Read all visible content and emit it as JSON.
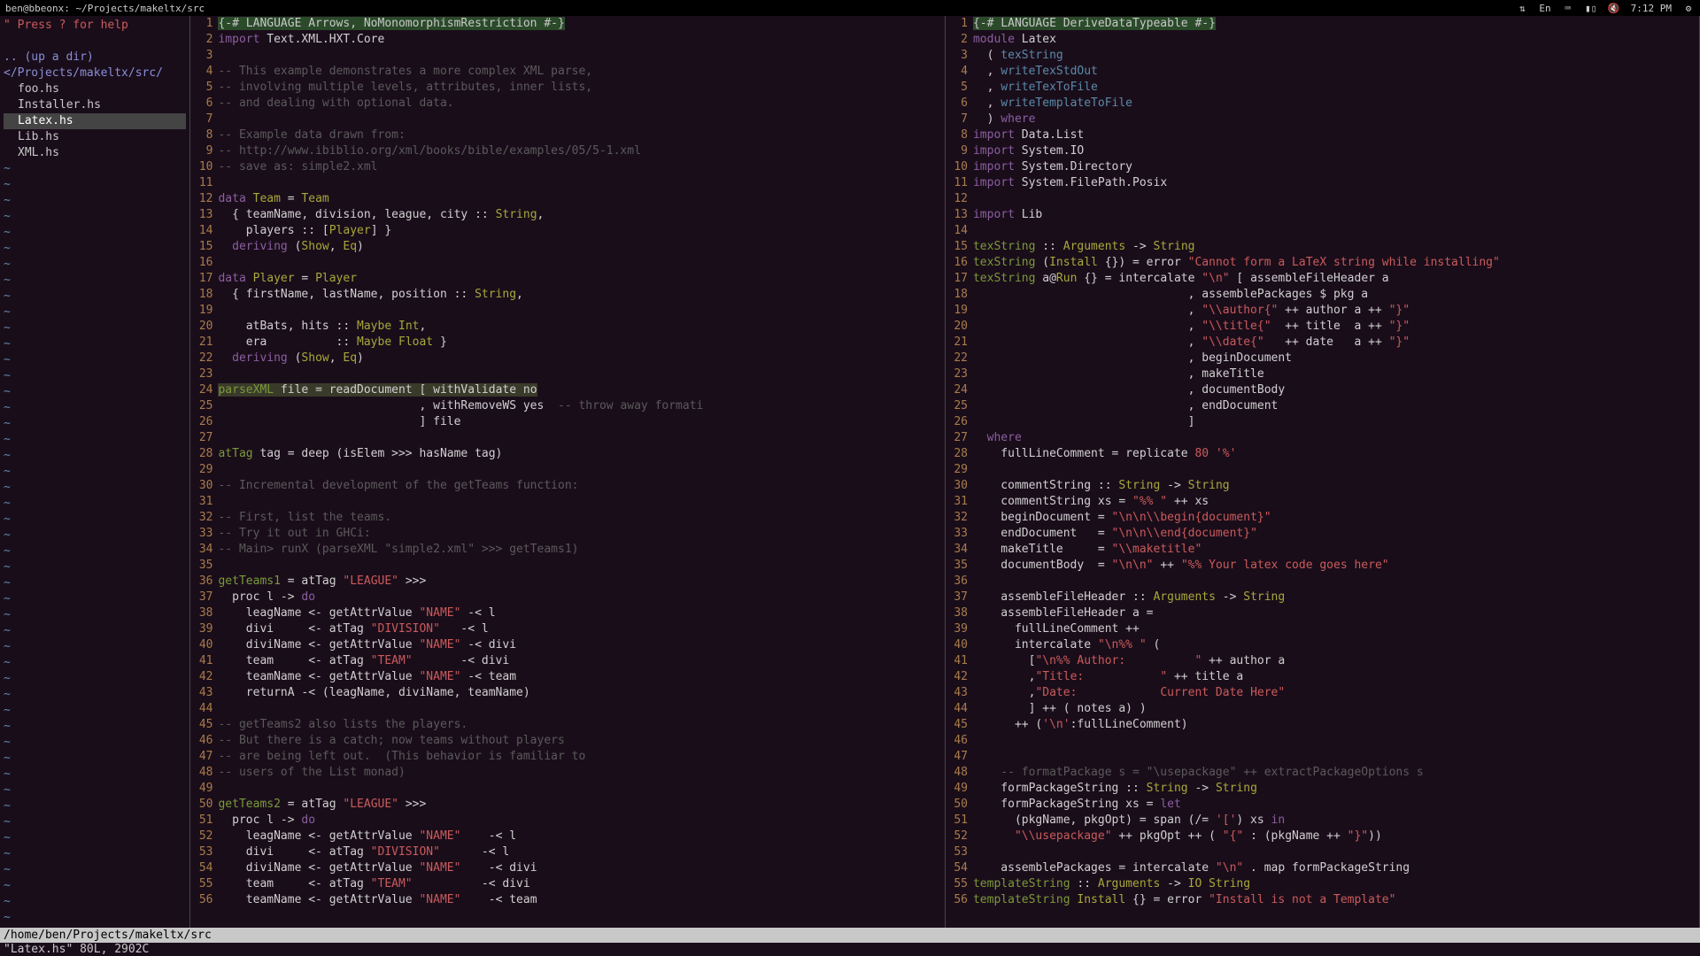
{
  "statusbar": {
    "title": "ben@bbeonx: ~/Projects/makeltx/src",
    "lang": "En",
    "time": "7:12 PM"
  },
  "filetree": {
    "help": "\" Press ? for help",
    "updir": ".. (up a dir)",
    "path": "</Projects/makeltx/src/",
    "files": [
      "foo.hs",
      "Installer.hs",
      "Latex.hs",
      "Lib.hs",
      "XML.hs"
    ],
    "selected": "Latex.hs"
  },
  "left_pane": {
    "lines": [
      {
        "n": 1,
        "html": "<span class='c-pragma'>{-# LANGUAGE Arrows, NoMonomorphismRestriction #-}</span>"
      },
      {
        "n": 2,
        "html": "<span class='c-kw'>import</span> Text.XML.HXT.Core"
      },
      {
        "n": 3,
        "html": ""
      },
      {
        "n": 4,
        "html": "<span class='c-cm'>-- This example demonstrates a more complex XML parse,</span>"
      },
      {
        "n": 5,
        "html": "<span class='c-cm'>-- involving multiple levels, attributes, inner lists,</span>"
      },
      {
        "n": 6,
        "html": "<span class='c-cm'>-- and dealing with optional data.</span>"
      },
      {
        "n": 7,
        "html": ""
      },
      {
        "n": 8,
        "html": "<span class='c-cm'>-- Example data drawn from:</span>"
      },
      {
        "n": 9,
        "html": "<span class='c-cm'>-- http://www.ibiblio.org/xml/books/bible/examples/05/5-1.xml</span>"
      },
      {
        "n": 10,
        "html": "<span class='c-cm'>-- save as: simple2.xml</span>"
      },
      {
        "n": 11,
        "html": ""
      },
      {
        "n": 12,
        "html": "<span class='c-kw'>data</span> <span class='c-ty'>Team</span> = <span class='c-ty'>Team</span>"
      },
      {
        "n": 13,
        "html": "  { teamName, division, league, city :: <span class='c-ty'>String</span>,"
      },
      {
        "n": 14,
        "html": "    players :: [<span class='c-ty'>Player</span>] }"
      },
      {
        "n": 15,
        "html": "  <span class='c-kw'>deriving</span> (<span class='c-ty'>Show</span>, <span class='c-ty'>Eq</span>)"
      },
      {
        "n": 16,
        "html": ""
      },
      {
        "n": 17,
        "html": "<span class='c-kw'>data</span> <span class='c-ty'>Player</span> = <span class='c-ty'>Player</span>"
      },
      {
        "n": 18,
        "html": "  { firstName, lastName, position :: <span class='c-ty'>String</span>,"
      },
      {
        "n": 19,
        "html": ""
      },
      {
        "n": 20,
        "html": "    atBats, hits :: <span class='c-ty'>Maybe Int</span>,"
      },
      {
        "n": 21,
        "html": "    era          :: <span class='c-ty'>Maybe Float</span> }"
      },
      {
        "n": 22,
        "html": "  <span class='c-kw'>deriving</span> (<span class='c-ty'>Show</span>, <span class='c-ty'>Eq</span>)"
      },
      {
        "n": 23,
        "html": ""
      },
      {
        "n": 24,
        "html": "<span class='c-hl'><span class='c-fn'>parseXML</span> file = readDocument [ withValidate no</span>"
      },
      {
        "n": 25,
        "html": "                             , withRemoveWS yes  <span class='c-cm'>-- throw away formati</span>"
      },
      {
        "n": 26,
        "html": "                             ] file"
      },
      {
        "n": 27,
        "html": ""
      },
      {
        "n": 28,
        "html": "<span class='c-fn'>atTag</span> tag = deep (isElem &gt;&gt;&gt; hasName tag)"
      },
      {
        "n": 29,
        "html": ""
      },
      {
        "n": 30,
        "html": "<span class='c-cm'>-- Incremental development of the getTeams function:</span>"
      },
      {
        "n": 31,
        "html": ""
      },
      {
        "n": 32,
        "html": "<span class='c-cm'>-- First, list the teams.</span>"
      },
      {
        "n": 33,
        "html": "<span class='c-cm'>-- Try it out in GHCi:</span>"
      },
      {
        "n": 34,
        "html": "<span class='c-cm'>-- Main&gt; runX (parseXML \"simple2.xml\" &gt;&gt;&gt; getTeams1)</span>"
      },
      {
        "n": 35,
        "html": ""
      },
      {
        "n": 36,
        "html": "<span class='c-fn'>getTeams1</span> = atTag <span class='c-st'>\"LEAGUE\"</span> &gt;&gt;&gt;"
      },
      {
        "n": 37,
        "html": "  proc l -&gt; <span class='c-kw'>do</span>"
      },
      {
        "n": 38,
        "html": "    leagName &lt;- getAttrValue <span class='c-st'>\"NAME\"</span> -&lt; l"
      },
      {
        "n": 39,
        "html": "    divi     &lt;- atTag <span class='c-st'>\"DIVISION\"</span>   -&lt; l"
      },
      {
        "n": 40,
        "html": "    diviName &lt;- getAttrValue <span class='c-st'>\"NAME\"</span> -&lt; divi"
      },
      {
        "n": 41,
        "html": "    team     &lt;- atTag <span class='c-st'>\"TEAM\"</span>       -&lt; divi"
      },
      {
        "n": 42,
        "html": "    teamName &lt;- getAttrValue <span class='c-st'>\"NAME\"</span> -&lt; team"
      },
      {
        "n": 43,
        "html": "    returnA -&lt; (leagName, diviName, teamName)"
      },
      {
        "n": 44,
        "html": ""
      },
      {
        "n": 45,
        "html": "<span class='c-cm'>-- getTeams2 also lists the players.</span>"
      },
      {
        "n": 46,
        "html": "<span class='c-cm'>-- But there is a catch; now teams without players</span>"
      },
      {
        "n": 47,
        "html": "<span class='c-cm'>-- are being left out.  (This behavior is familiar to</span>"
      },
      {
        "n": 48,
        "html": "<span class='c-cm'>-- users of the List monad)</span>"
      },
      {
        "n": 49,
        "html": ""
      },
      {
        "n": 50,
        "html": "<span class='c-fn'>getTeams2</span> = atTag <span class='c-st'>\"LEAGUE\"</span> &gt;&gt;&gt;"
      },
      {
        "n": 51,
        "html": "  proc l -&gt; <span class='c-kw'>do</span>"
      },
      {
        "n": 52,
        "html": "    leagName &lt;- getAttrValue <span class='c-st'>\"NAME\"</span>    -&lt; l"
      },
      {
        "n": 53,
        "html": "    divi     &lt;- atTag <span class='c-st'>\"DIVISION\"</span>      -&lt; l"
      },
      {
        "n": 54,
        "html": "    diviName &lt;- getAttrValue <span class='c-st'>\"NAME\"</span>    -&lt; divi"
      },
      {
        "n": 55,
        "html": "    team     &lt;- atTag <span class='c-st'>\"TEAM\"</span>          -&lt; divi"
      },
      {
        "n": 56,
        "html": "    teamName &lt;- getAttrValue <span class='c-st'>\"NAME\"</span>    -&lt; team"
      }
    ]
  },
  "right_pane": {
    "lines": [
      {
        "n": 1,
        "html": "<span class='c-pragma'>{-# LANGUAGE DeriveDataTypeable #-}</span>"
      },
      {
        "n": 2,
        "html": "<span class='c-kw'>module</span> Latex"
      },
      {
        "n": 3,
        "html": "  ( <span class='c-sp'>texString</span>"
      },
      {
        "n": 4,
        "html": "  , <span class='c-sp'>writeTexStdOut</span>"
      },
      {
        "n": 5,
        "html": "  , <span class='c-sp'>writeTexToFile</span>"
      },
      {
        "n": 6,
        "html": "  , <span class='c-sp'>writeTemplateToFile</span>"
      },
      {
        "n": 7,
        "html": "  ) <span class='c-kw'>where</span>"
      },
      {
        "n": 8,
        "html": "<span class='c-kw'>import</span> Data.List"
      },
      {
        "n": 9,
        "html": "<span class='c-kw'>import</span> System.IO"
      },
      {
        "n": 10,
        "html": "<span class='c-kw'>import</span> System.Directory"
      },
      {
        "n": 11,
        "html": "<span class='c-kw'>import</span> System.FilePath.Posix"
      },
      {
        "n": 12,
        "html": ""
      },
      {
        "n": 13,
        "html": "<span class='c-kw'>import</span> Lib"
      },
      {
        "n": 14,
        "html": ""
      },
      {
        "n": 15,
        "html": "<span class='c-fn'>texString</span> :: <span class='c-ty'>Arguments</span> -&gt; <span class='c-ty'>String</span>"
      },
      {
        "n": 16,
        "html": "<span class='c-fn'>texString</span> (<span class='c-ty'>Install</span> {}) = error <span class='c-st'>\"Cannot form a LaTeX string while installing\"</span>"
      },
      {
        "n": 17,
        "html": "<span class='c-fn'>texString</span> a@<span class='c-ty'>Run</span> {} = intercalate <span class='c-st'>\"\\n\"</span> [ assembleFileHeader a"
      },
      {
        "n": 18,
        "html": "                               , assemblePackages $ pkg a"
      },
      {
        "n": 19,
        "html": "                               , <span class='c-st'>\"\\\\author{\"</span> ++ author a ++ <span class='c-st'>\"}\"</span>"
      },
      {
        "n": 20,
        "html": "                               , <span class='c-st'>\"\\\\title{\"</span>  ++ title  a ++ <span class='c-st'>\"}\"</span>"
      },
      {
        "n": 21,
        "html": "                               , <span class='c-st'>\"\\\\date{\"</span>   ++ date   a ++ <span class='c-st'>\"}\"</span>"
      },
      {
        "n": 22,
        "html": "                               , beginDocument"
      },
      {
        "n": 23,
        "html": "                               , makeTitle"
      },
      {
        "n": 24,
        "html": "                               , documentBody"
      },
      {
        "n": 25,
        "html": "                               , endDocument"
      },
      {
        "n": 26,
        "html": "                               ]"
      },
      {
        "n": 27,
        "html": "  <span class='c-kw'>where</span>"
      },
      {
        "n": 28,
        "html": "    fullLineComment = replicate <span class='c-nu'>80</span> <span class='c-st'>'%'</span>"
      },
      {
        "n": 29,
        "html": ""
      },
      {
        "n": 30,
        "html": "    commentString :: <span class='c-ty'>String</span> -&gt; <span class='c-ty'>String</span>"
      },
      {
        "n": 31,
        "html": "    commentString xs = <span class='c-st'>\"%% \"</span> ++ xs"
      },
      {
        "n": 32,
        "html": "    beginDocument = <span class='c-st'>\"\\n\\n\\\\begin{document}\"</span>"
      },
      {
        "n": 33,
        "html": "    endDocument   = <span class='c-st'>\"\\n\\n\\\\end{document}\"</span>"
      },
      {
        "n": 34,
        "html": "    makeTitle     = <span class='c-st'>\"\\\\maketitle\"</span>"
      },
      {
        "n": 35,
        "html": "    documentBody  = <span class='c-st'>\"\\n\\n\"</span> ++ <span class='c-st'>\"%% Your latex code goes here\"</span>"
      },
      {
        "n": 36,
        "html": ""
      },
      {
        "n": 37,
        "html": "    assembleFileHeader :: <span class='c-ty'>Arguments</span> -&gt; <span class='c-ty'>String</span>"
      },
      {
        "n": 38,
        "html": "    assembleFileHeader a ="
      },
      {
        "n": 39,
        "html": "      fullLineComment ++"
      },
      {
        "n": 40,
        "html": "      intercalate <span class='c-st'>\"\\n%% \"</span> ("
      },
      {
        "n": 41,
        "html": "        [<span class='c-st'>\"\\n%% Author:          \"</span> ++ author a"
      },
      {
        "n": 42,
        "html": "        ,<span class='c-st'>\"Title:           \"</span> ++ title a"
      },
      {
        "n": 43,
        "html": "        ,<span class='c-st'>\"Date:            Current Date Here\"</span>"
      },
      {
        "n": 44,
        "html": "        ] ++ ( notes a) )"
      },
      {
        "n": 45,
        "html": "      ++ (<span class='c-st'>'\\n'</span>:fullLineComment)"
      },
      {
        "n": 46,
        "html": ""
      },
      {
        "n": 47,
        "html": ""
      },
      {
        "n": 48,
        "html": "    <span class='c-cm'>-- formatPackage s = \"\\usepackage\" ++ extractPackageOptions s</span>"
      },
      {
        "n": 49,
        "html": "    formPackageString :: <span class='c-ty'>String</span> -&gt; <span class='c-ty'>String</span>"
      },
      {
        "n": 50,
        "html": "    formPackageString xs = <span class='c-kw'>let</span>"
      },
      {
        "n": 51,
        "html": "      (pkgName, pkgOpt) = span (/= <span class='c-st'>'['</span>) xs <span class='c-kw'>in</span>"
      },
      {
        "n": 52,
        "html": "      <span class='c-st'>\"\\\\usepackage\"</span> ++ pkgOpt ++ ( <span class='c-st'>\"{\"</span> : (pkgName ++ <span class='c-st'>\"}\"</span>))"
      },
      {
        "n": 53,
        "html": ""
      },
      {
        "n": 54,
        "html": "    assemblePackages = intercalate <span class='c-st'>\"\\n\"</span> . map formPackageString"
      },
      {
        "n": 55,
        "html": "<span class='c-fn'>templateString</span> :: <span class='c-ty'>Arguments</span> -&gt; <span class='c-ty'>IO String</span>"
      },
      {
        "n": 56,
        "html": "<span class='c-fn'>templateString</span> <span class='c-ty'>Install</span> {} = error <span class='c-st'>\"Install is not a Template\"</span>"
      }
    ]
  },
  "bottom": {
    "path": "/home/ben/Projects/makeltx/src",
    "msg": "\"Latex.hs\" 80L, 2902C"
  }
}
